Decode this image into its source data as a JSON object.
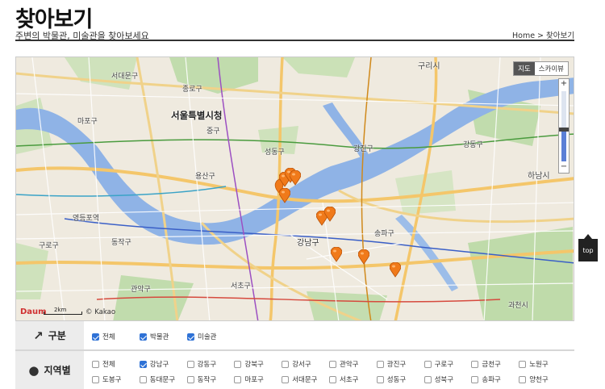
{
  "header": {
    "title": "찾아보기",
    "subtitle": "주변의 박물관, 미술관을 찾아보세요",
    "breadcrumb": "Home > 찾아보기"
  },
  "map": {
    "type_buttons": [
      "지도",
      "스카이뷰"
    ],
    "active_type": "지도",
    "zoom_in": "+",
    "zoom_out": "−",
    "zoom_level_fraction": 0.42,
    "logo": "Daum",
    "scale": "2km",
    "copyright": "© Kakao",
    "labels": {
      "seoul_cityhall": "서울특별시청",
      "gangnam": "강남구",
      "gwangjin": "광진구",
      "gangdong": "강동구",
      "songpa": "송파구",
      "seocho": "서초구",
      "jung": "중구",
      "yongsan": "용산구",
      "mapo": "마포구",
      "dongjak": "동작구",
      "gwanak": "관악구",
      "seodaemun": "서대문구",
      "jongno": "종로구",
      "seongdong": "성동구",
      "guro": "구로구",
      "yeongdeungpo": "영등포역",
      "guri": "구리시",
      "hanam": "하남시",
      "gwacheon": "과천시"
    },
    "marker_count": 9
  },
  "filters": {
    "category": {
      "heading": "구분",
      "icon": "tag-icon",
      "options": [
        {
          "label": "전체",
          "checked": true
        },
        {
          "label": "박물관",
          "checked": true
        },
        {
          "label": "미술관",
          "checked": true
        }
      ]
    },
    "region": {
      "heading": "지역별",
      "icon": "globe-icon",
      "row1": [
        {
          "label": "전체",
          "checked": false
        },
        {
          "label": "강남구",
          "checked": true
        },
        {
          "label": "강동구",
          "checked": false
        },
        {
          "label": "강북구",
          "checked": false
        },
        {
          "label": "강서구",
          "checked": false
        },
        {
          "label": "관악구",
          "checked": false
        },
        {
          "label": "광진구",
          "checked": false
        },
        {
          "label": "구로구",
          "checked": false
        },
        {
          "label": "금천구",
          "checked": false
        },
        {
          "label": "노원구",
          "checked": false
        }
      ],
      "row2": [
        {
          "label": "도봉구",
          "checked": false
        },
        {
          "label": "동대문구",
          "checked": false
        },
        {
          "label": "동작구",
          "checked": false
        },
        {
          "label": "마포구",
          "checked": false
        },
        {
          "label": "서대문구",
          "checked": false
        },
        {
          "label": "서초구",
          "checked": false
        },
        {
          "label": "성동구",
          "checked": false
        },
        {
          "label": "성북구",
          "checked": false
        },
        {
          "label": "송파구",
          "checked": false
        },
        {
          "label": "양천구",
          "checked": false
        }
      ]
    }
  },
  "top_button": "top",
  "colors": {
    "river": "#8fb3e6",
    "park": "#b9d9a4",
    "marker": "#f07a1a",
    "checkbox_on": "#2f72d6"
  }
}
